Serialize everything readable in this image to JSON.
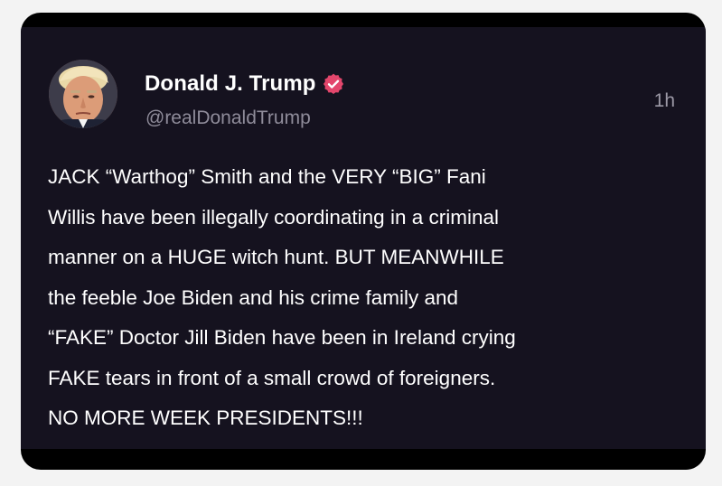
{
  "tweet": {
    "display_name": "Donald J. Trump",
    "handle": "@realDonaldTrump",
    "time": "1h",
    "verified": true,
    "verified_color": "#e3466c",
    "text": "JACK “Warthog” Smith and the VERY “BIG” Fani\nWillis have been illegally coordinating in a criminal\nmanner on a HUGE witch hunt. BUT MEANWHILE\nthe feeble Joe Biden and his crime family and\n“FAKE” Doctor Jill Biden have been in Ireland crying\nFAKE tears in front of a small crowd of foreigners.\nNO MORE WEEK PRESIDENTS!!!"
  },
  "icons": {
    "verified": "verified-badge-icon",
    "avatar": "profile-avatar"
  },
  "colors": {
    "card_background": "#15121f",
    "frame_background": "#000000",
    "page_background": "#f3f3f3",
    "text_primary": "#ffffff",
    "text_secondary": "#8f8c9a"
  }
}
